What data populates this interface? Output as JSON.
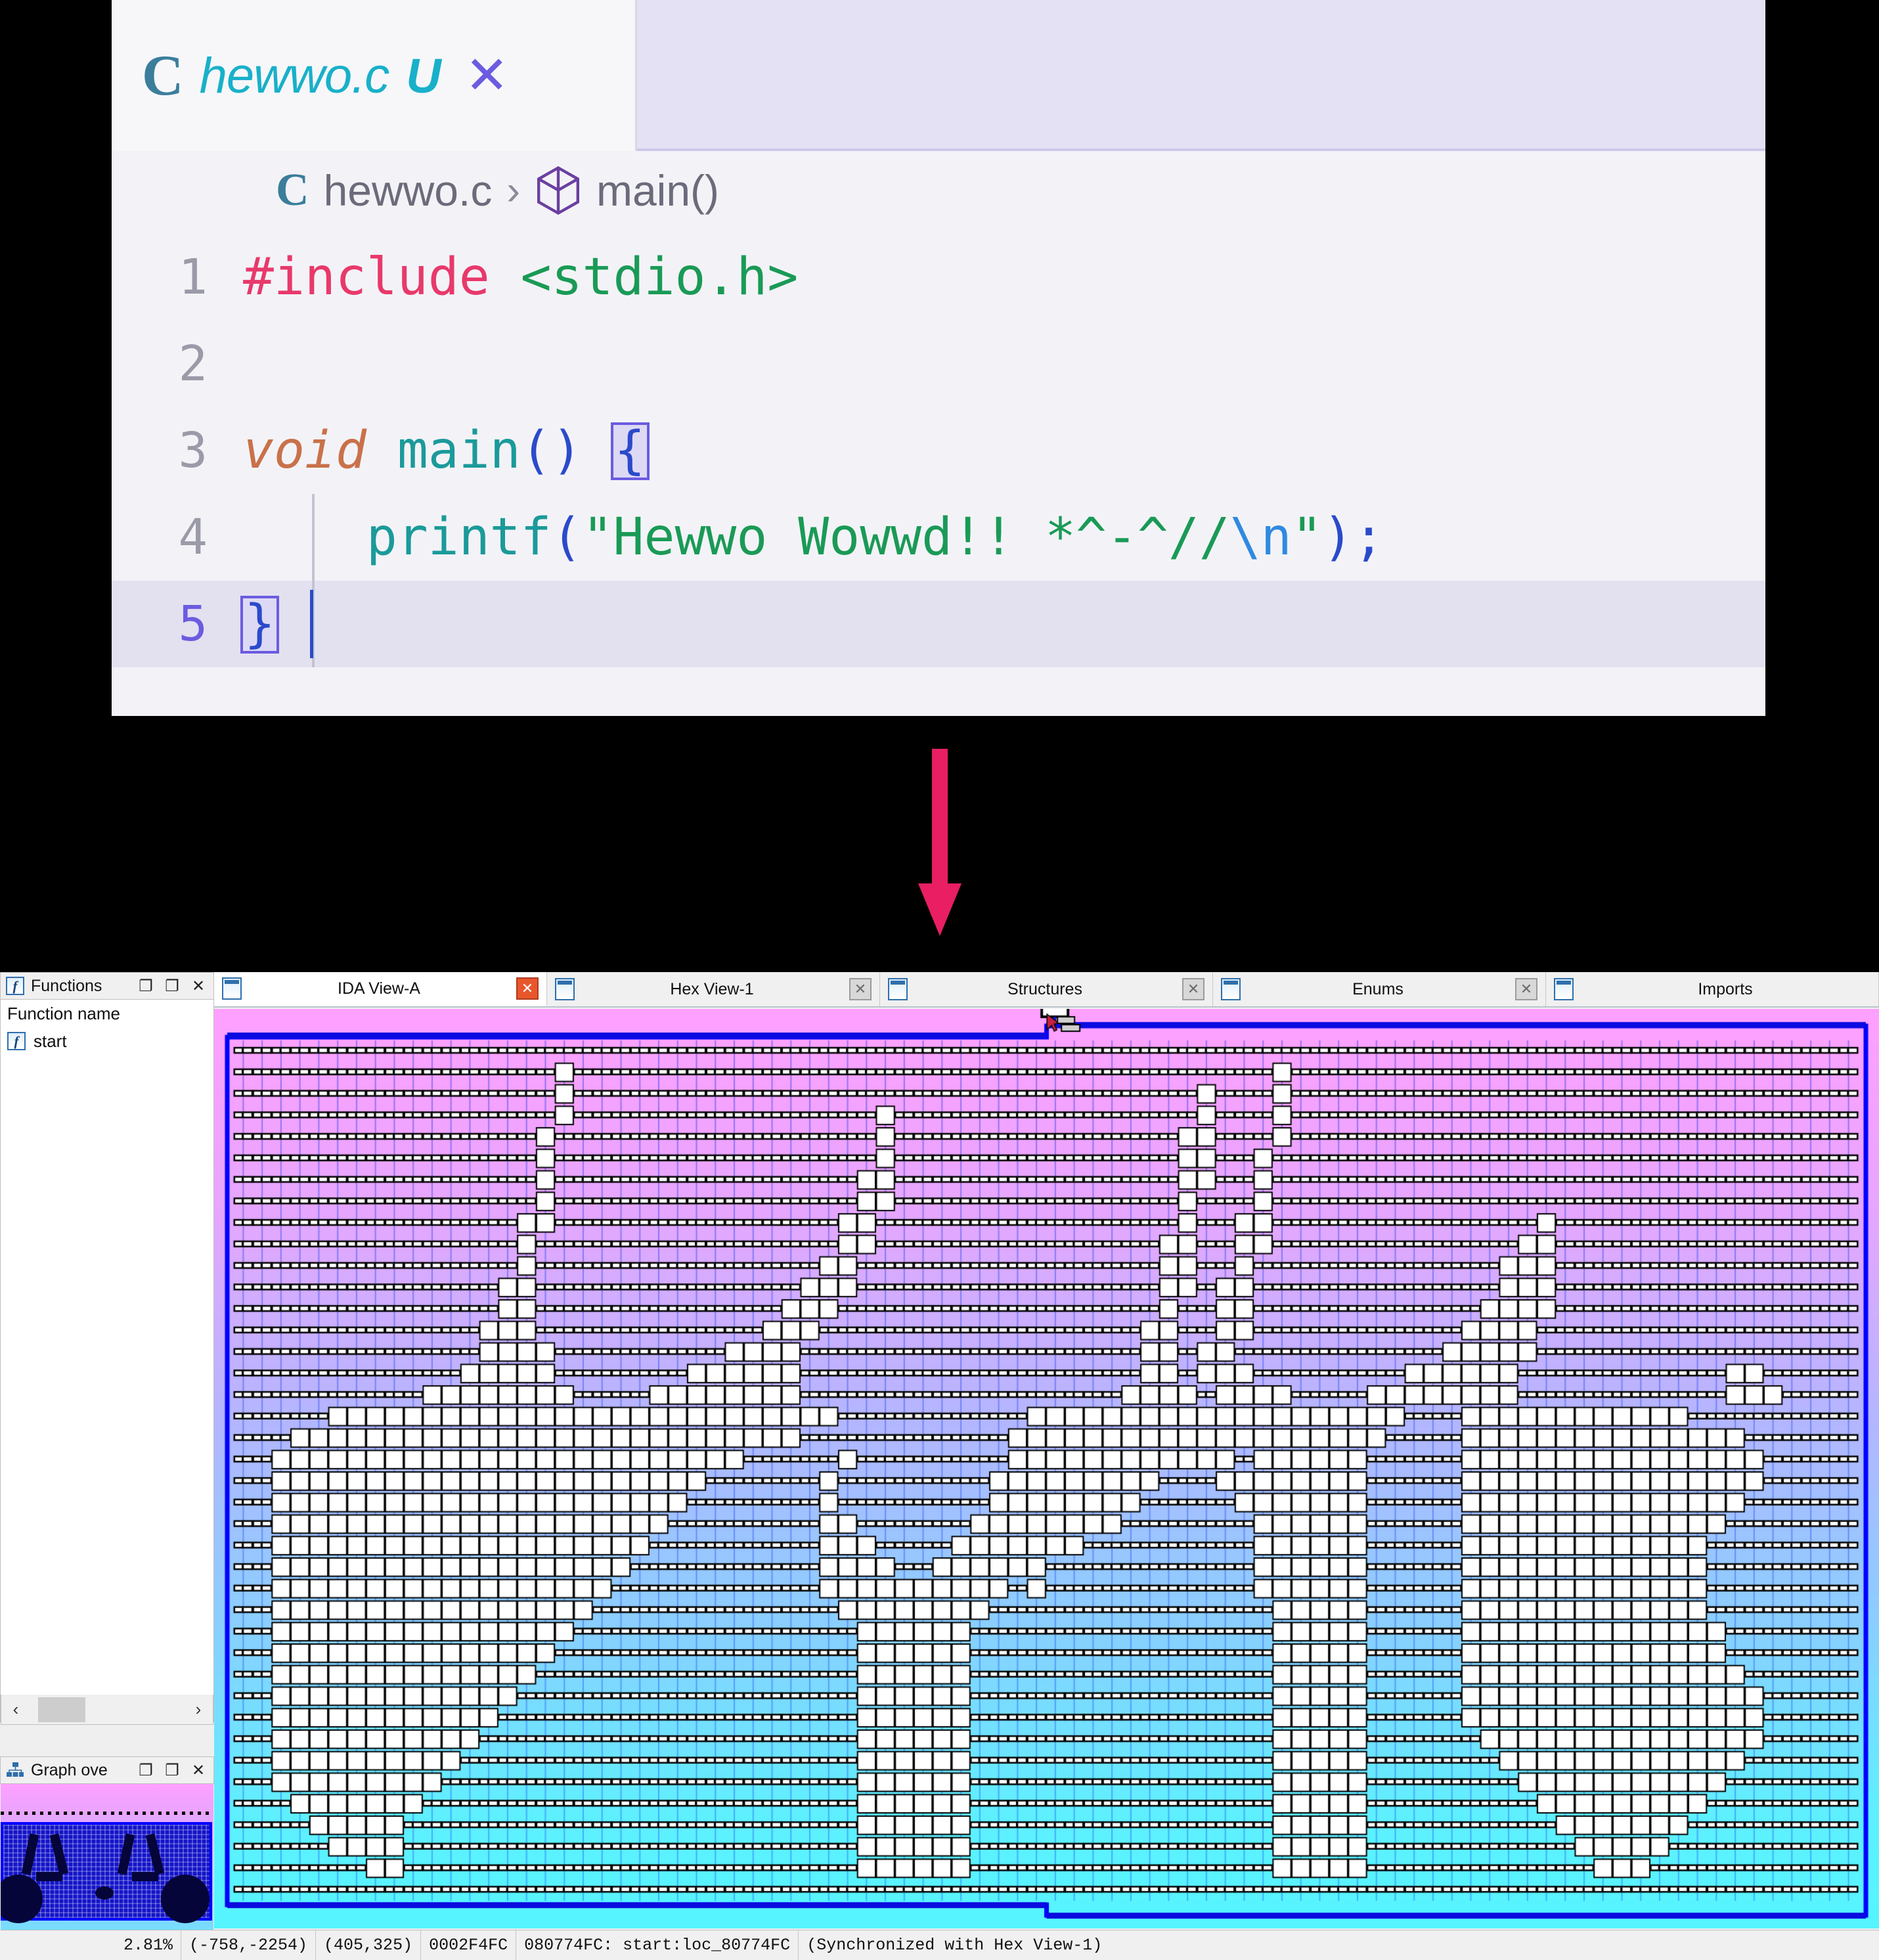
{
  "editor": {
    "tab": {
      "lang_icon": "c-file-icon",
      "filename": "hewwo.c",
      "unsaved_badge": "U",
      "close_glyph": "✕"
    },
    "breadcrumb": {
      "lang_icon": "c-file-icon",
      "file": "hewwo.c",
      "separator": "›",
      "symbol_icon": "cube-symbol-icon",
      "symbol": "main()"
    },
    "lines": [
      {
        "num": "1",
        "tokens": [
          {
            "t": "#include ",
            "c": "tk-pre"
          },
          {
            "t": "<stdio.h>",
            "c": "tk-hdr"
          }
        ]
      },
      {
        "num": "2",
        "tokens": []
      },
      {
        "num": "3",
        "tokens": [
          {
            "t": "void",
            "c": "tk-kw"
          },
          {
            "t": " ",
            "c": ""
          },
          {
            "t": "main",
            "c": "tk-fn"
          },
          {
            "t": "()",
            "c": "tk-pun"
          },
          {
            "t": " ",
            "c": ""
          },
          {
            "t": "{",
            "c": "tk-pun bracket-box"
          }
        ]
      },
      {
        "num": "4",
        "tokens": [
          {
            "t": "    ",
            "c": ""
          },
          {
            "t": "printf",
            "c": "tk-fn"
          },
          {
            "t": "(",
            "c": "tk-pun"
          },
          {
            "t": "\"Hewwo Wowwd!! *^-^//",
            "c": "tk-str"
          },
          {
            "t": "\\n",
            "c": "tk-esc"
          },
          {
            "t": "\"",
            "c": "tk-str"
          },
          {
            "t": ")",
            "c": "tk-pun"
          },
          {
            "t": ";",
            "c": "tk-pun"
          }
        ]
      },
      {
        "num": "5",
        "tokens": [
          {
            "t": "}",
            "c": "tk-pun bracket-box"
          }
        ],
        "active": true,
        "caret": true
      }
    ]
  },
  "arrow": {
    "name": "down-arrow",
    "color": "#e91e63"
  },
  "ida": {
    "functions_panel": {
      "title": "Functions",
      "icon": "function-icon",
      "buttons": [
        "❐",
        "❐",
        "✕"
      ],
      "column_header": "Function name",
      "rows": [
        {
          "icon": "function-icon",
          "name": "start"
        }
      ],
      "scroll_left": "‹",
      "scroll_right": "›"
    },
    "graph_overview_panel": {
      "title": "Graph ove",
      "icon": "graph-overview-icon",
      "buttons": [
        "❐",
        "❐",
        "✕"
      ]
    },
    "tabs": [
      {
        "label": "IDA View-A",
        "icon": "listing-icon",
        "close": "✕",
        "active": true,
        "close_hot": true
      },
      {
        "label": "Hex View-1",
        "icon": "hex-icon",
        "close": "✕",
        "active": false,
        "close_hot": false
      },
      {
        "label": "Structures",
        "icon": "struct-icon",
        "close": "✕",
        "active": false,
        "close_hot": false
      },
      {
        "label": "Enums",
        "icon": "enums-icon",
        "close": "✕",
        "active": false,
        "close_hot": false
      },
      {
        "label": "Imports",
        "icon": "imports-icon",
        "close": "",
        "active": false,
        "close_hot": false
      }
    ],
    "status_bar": {
      "zoom": "2.81%",
      "graph_coords": "(-758,-2254)",
      "screen_coords": "(405,325)",
      "file_offset": "0002F4FC",
      "address": "080774FC: start:loc_80774FC",
      "sync": "(Synchronized with Hex View-1)"
    },
    "graph_colors": {
      "bg_top": "#ffa0ff",
      "bg_bottom": "#55f5ff",
      "node_fill": "#ffffff",
      "node_border": "#000000",
      "edge": "#3333ee",
      "outline": "#0000ff"
    }
  }
}
